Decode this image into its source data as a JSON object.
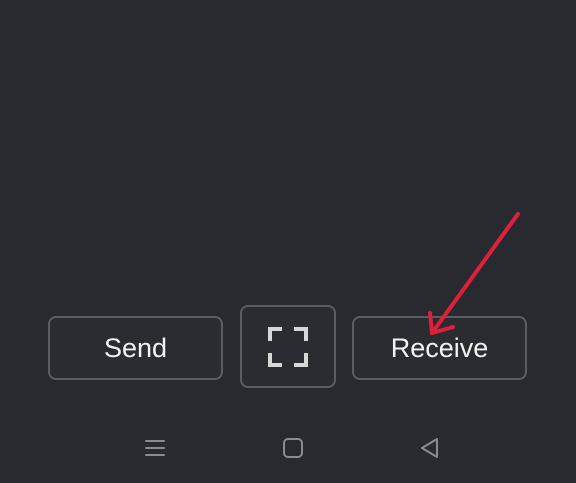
{
  "buttons": {
    "send_label": "Send",
    "receive_label": "Receive"
  },
  "icons": {
    "scan": "scan-frame-icon",
    "nav_menu": "menu-icon",
    "nav_home": "home-square-icon",
    "nav_back": "back-triangle-icon",
    "annotation": "red-arrow-icon"
  },
  "colors": {
    "background": "#282a30",
    "button_border": "#5a5d63",
    "text": "#f2f2f2",
    "nav_icon": "#8a8c90",
    "annotation": "#e0203a"
  }
}
